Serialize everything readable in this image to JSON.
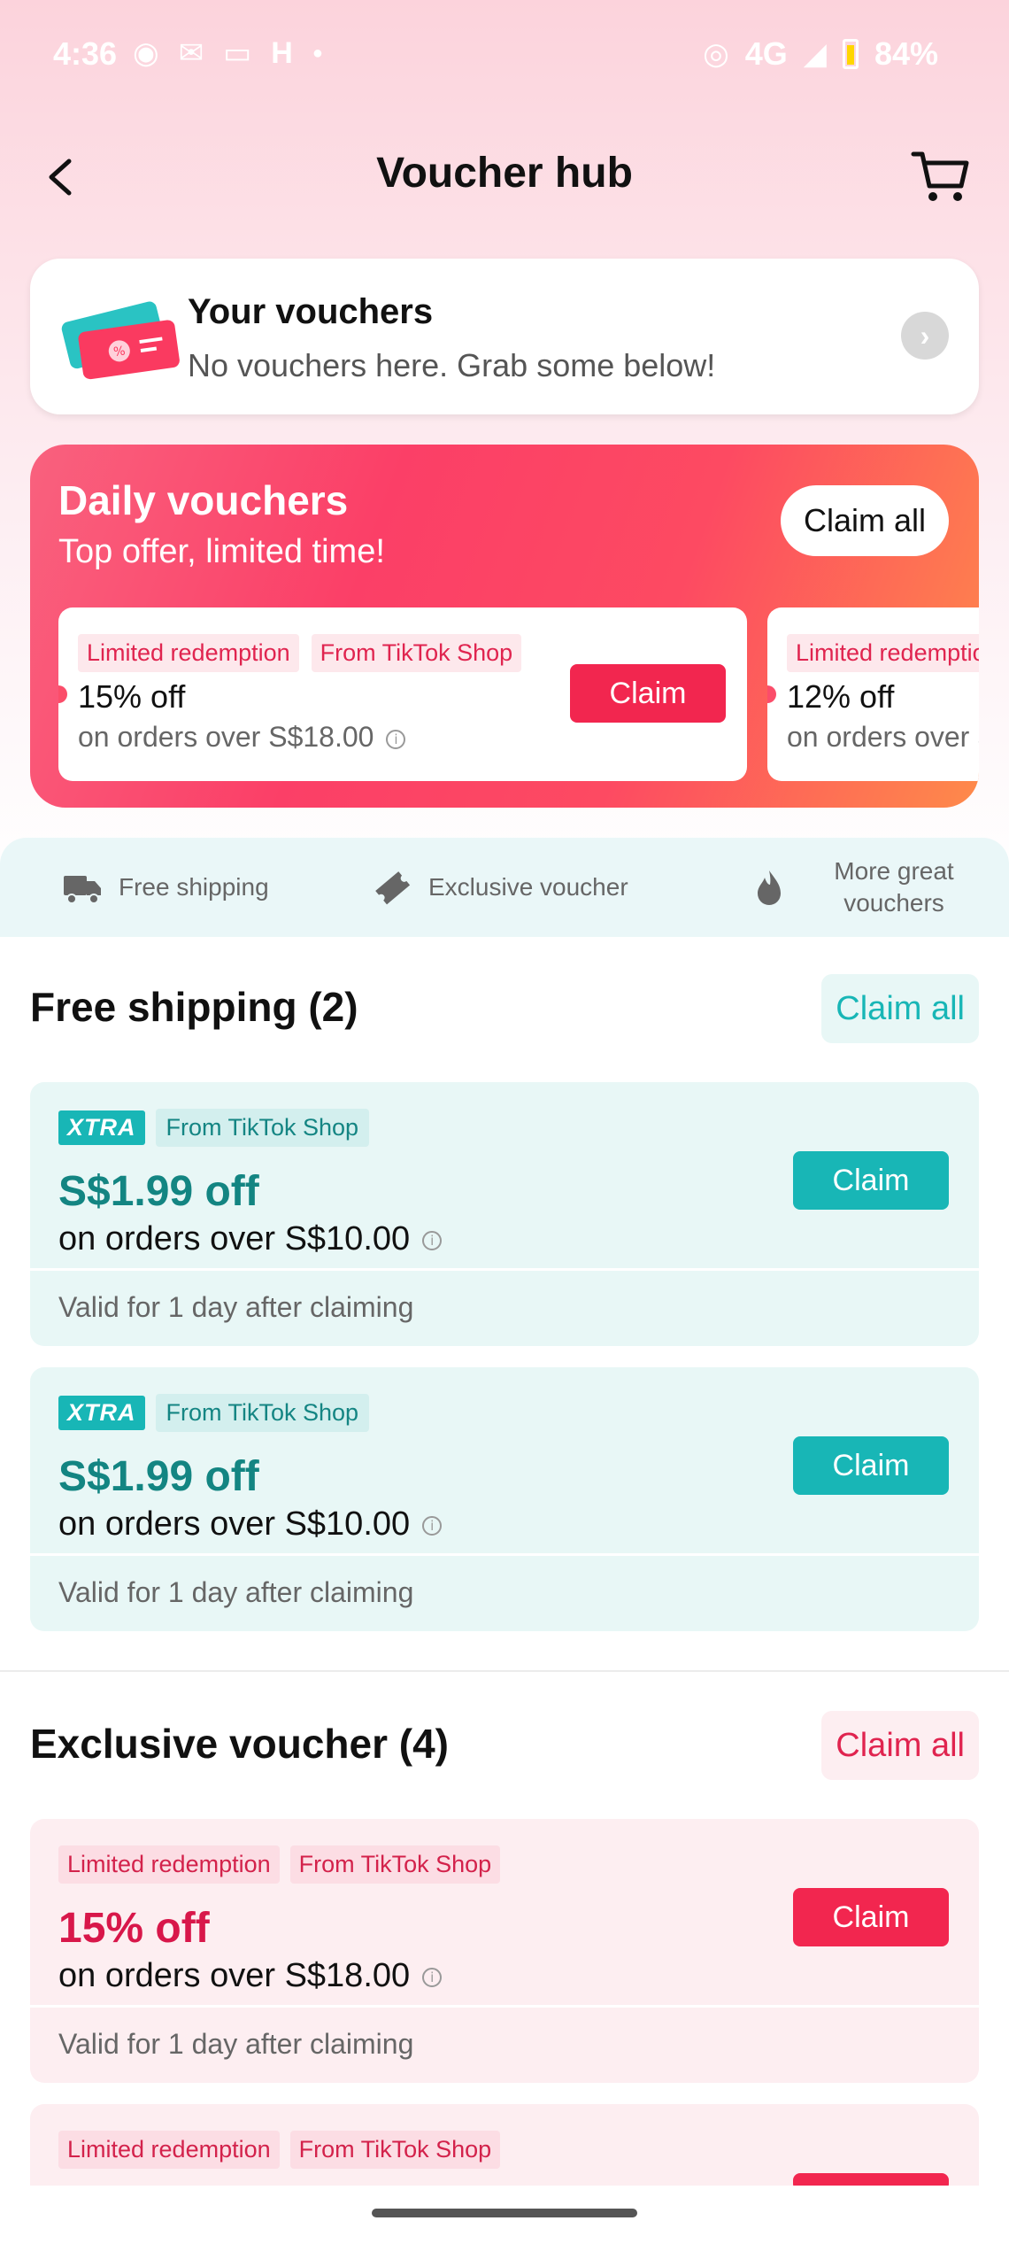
{
  "status_bar": {
    "time": "4:36",
    "network": "4G",
    "battery": "84%"
  },
  "header": {
    "title": "Voucher hub"
  },
  "your_vouchers": {
    "title": "Your vouchers",
    "subtitle": "No vouchers here. Grab some below!"
  },
  "daily": {
    "title": "Daily vouchers",
    "subtitle": "Top offer, limited time!",
    "claim_all": "Claim all",
    "cards": [
      {
        "tag1": "Limited redemption",
        "tag2": "From TikTok Shop",
        "amount": "15% off",
        "condition": "on orders over S$18.00",
        "claim": "Claim"
      },
      {
        "tag1": "Limited redemption",
        "amount": "12% off",
        "condition": "on orders over S$"
      }
    ]
  },
  "categories": [
    {
      "label": "Free shipping",
      "icon": "truck-icon"
    },
    {
      "label": "Exclusive voucher",
      "icon": "ticket-icon"
    },
    {
      "label": "More great vouchers",
      "icon": "flame-icon"
    }
  ],
  "free_shipping": {
    "title": "Free shipping (2)",
    "claim_all": "Claim all",
    "cards": [
      {
        "badge": "XTRA",
        "source": "From TikTok Shop",
        "amount": "S$1.99 off",
        "condition": "on orders over S$10.00",
        "validity": "Valid for 1 day after claiming",
        "claim": "Claim"
      },
      {
        "badge": "XTRA",
        "source": "From TikTok Shop",
        "amount": "S$1.99 off",
        "condition": "on orders over S$10.00",
        "validity": "Valid for 1 day after claiming",
        "claim": "Claim"
      }
    ]
  },
  "exclusive": {
    "title": "Exclusive voucher (4)",
    "claim_all": "Claim all",
    "cards": [
      {
        "tag1": "Limited redemption",
        "tag2": "From TikTok Shop",
        "amount": "15% off",
        "condition": "on orders over S$18.00",
        "validity": "Valid for 1 day after claiming",
        "claim": "Claim"
      },
      {
        "tag1": "Limited redemption",
        "tag2": "From TikTok Shop"
      }
    ]
  },
  "colors": {
    "accent_red": "#f2264f",
    "accent_teal": "#18b6b6"
  }
}
